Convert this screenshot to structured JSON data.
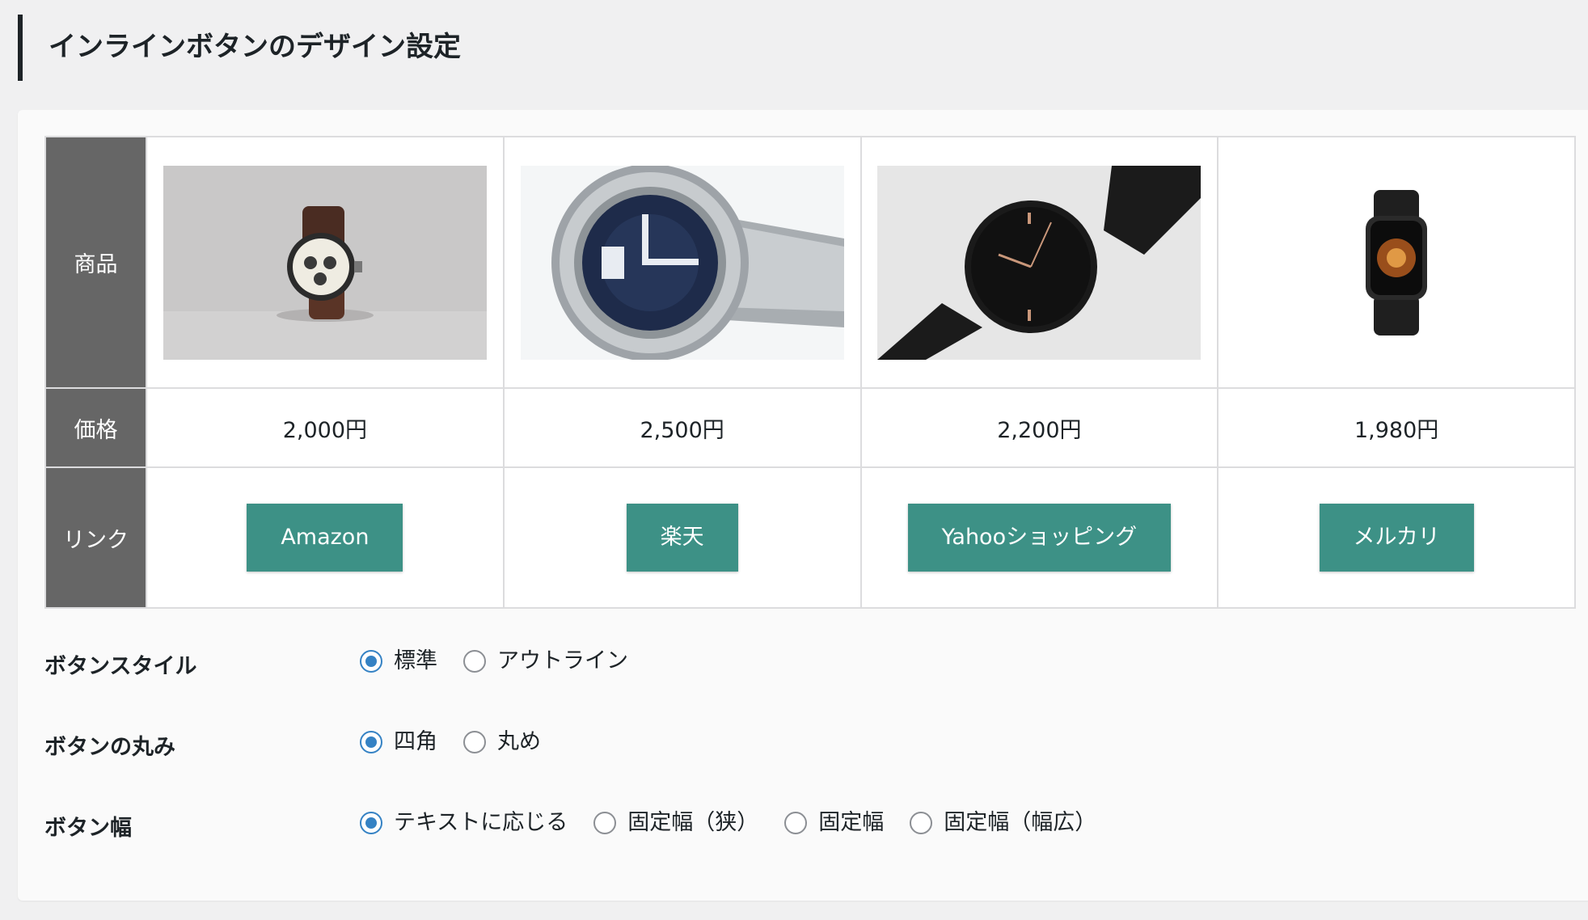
{
  "page": {
    "title": "インラインボタンのデザイン設定"
  },
  "table": {
    "headers": {
      "product": "商品",
      "price": "価格",
      "link": "リンク"
    },
    "products": [
      {
        "image_icon": "watch-chronograph-image",
        "price": "2,000円",
        "button_label": "Amazon"
      },
      {
        "image_icon": "watch-steel-image",
        "price": "2,500円",
        "button_label": "楽天"
      },
      {
        "image_icon": "watch-black-mesh-image",
        "price": "2,200円",
        "button_label": "Yahooショッピング"
      },
      {
        "image_icon": "smartwatch-image",
        "price": "1,980円",
        "button_label": "メルカリ"
      }
    ],
    "button_color": "#3d9186"
  },
  "settings": {
    "button_style": {
      "label": "ボタンスタイル",
      "options": [
        "標準",
        "アウトライン"
      ],
      "selected": "標準"
    },
    "button_radius": {
      "label": "ボタンの丸み",
      "options": [
        "四角",
        "丸め"
      ],
      "selected": "四角"
    },
    "button_width": {
      "label": "ボタン幅",
      "options": [
        "テキストに応じる",
        "固定幅（狭）",
        "固定幅",
        "固定幅（幅広）"
      ],
      "selected": "テキストに応じる"
    }
  },
  "colors": {
    "accent": "#3582c4",
    "header_bg": "#666666"
  }
}
